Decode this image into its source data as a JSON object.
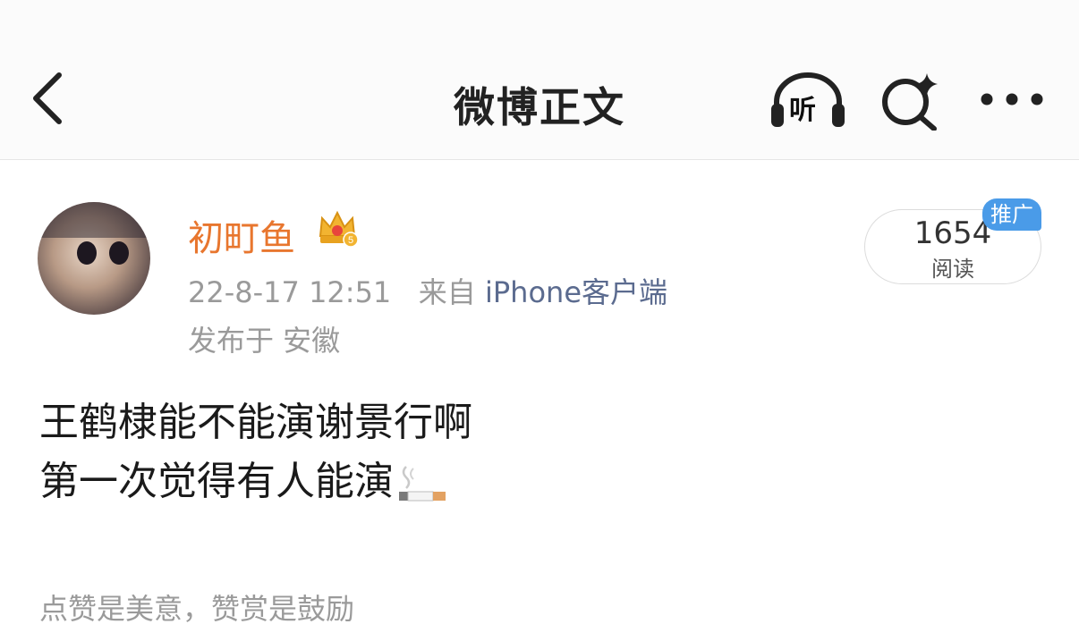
{
  "header": {
    "title": "微博正文",
    "listen_label": "听",
    "icons": [
      "back-chevron-icon",
      "headphones-icon",
      "sparkle-search-icon",
      "more-dots-icon"
    ]
  },
  "post": {
    "username": "初町鱼",
    "badge_icon": "crown-vip-icon",
    "timestamp": "22-8-17 12:51",
    "source_prefix": "来自",
    "source_client": "iPhone客户端",
    "location": "发布于 安徽",
    "read_count": "1654",
    "read_label": "阅读",
    "promo_badge": "推广",
    "content_lines": [
      "王鹤棣能不能演谢景行啊",
      "第一次觉得有人能演"
    ],
    "content_emoji": "cigarette-emoji"
  },
  "footer": {
    "reward_text": "点赞是美意，赞赏是鼓励"
  },
  "colors": {
    "username": "#e8762e",
    "source_link": "#5b6b8f",
    "promo": "#4a9be8",
    "meta_gray": "#9a9a9a"
  }
}
